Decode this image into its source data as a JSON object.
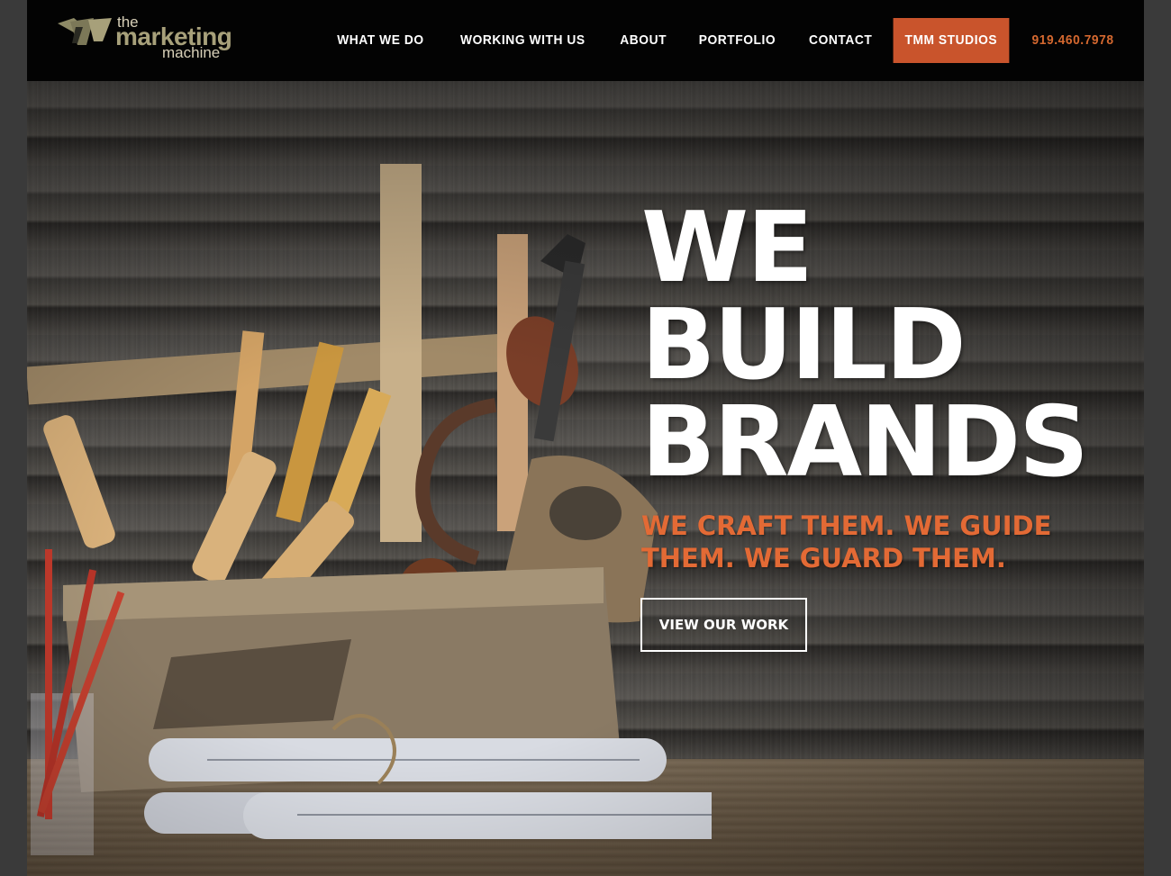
{
  "logo": {
    "the": "the",
    "marketing": "marketing",
    "machine": "machine",
    "icon": "tmm-logo-mark"
  },
  "nav": {
    "items": [
      {
        "label": "WHAT WE DO"
      },
      {
        "label": "WORKING WITH US"
      },
      {
        "label": "ABOUT"
      },
      {
        "label": "PORTFOLIO"
      },
      {
        "label": "CONTACT"
      }
    ],
    "cta": "TMM STUDIOS",
    "phone": "919.460.7978"
  },
  "hero": {
    "headline": [
      "WE",
      "BUILD",
      "BRANDS"
    ],
    "subline": "WE CRAFT THEM. WE GUIDE THEM. WE GUARD THEM.",
    "button": "VIEW OUR WORK",
    "image": "toolbox-with-woodworking-tools-photo"
  },
  "colors": {
    "accent": "#c9542c",
    "subline": "#e36a35",
    "logo_olive": "#a7a07a",
    "header_bg": "#030303"
  }
}
